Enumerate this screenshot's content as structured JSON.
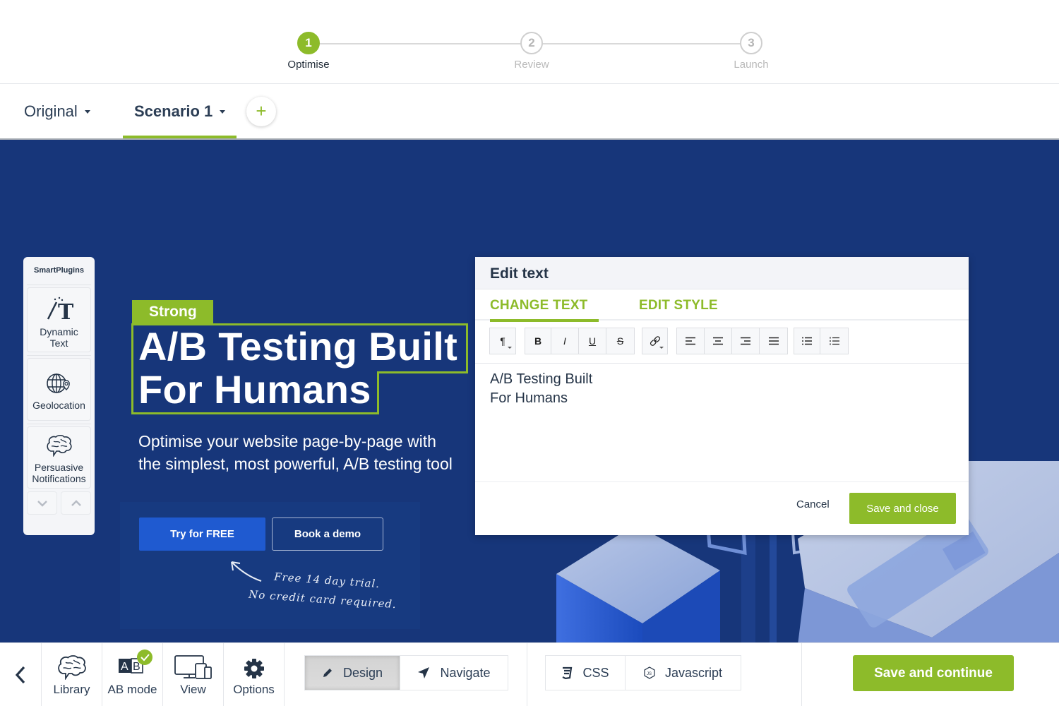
{
  "stepper": {
    "steps": [
      {
        "number": "1",
        "label": "Optimise",
        "state": "active"
      },
      {
        "number": "2",
        "label": "Review",
        "state": "inactive"
      },
      {
        "number": "3",
        "label": "Launch",
        "state": "inactive"
      }
    ]
  },
  "scenarios": {
    "tabs": [
      {
        "label": "Original",
        "active": false
      },
      {
        "label": "Scenario 1",
        "active": true
      }
    ],
    "add_label": "+"
  },
  "smart_plugins": {
    "title": "SmartPlugins",
    "items": [
      {
        "label_line1": "Dynamic",
        "label_line2": "Text",
        "icon": "dynamic-text-icon"
      },
      {
        "label_line1": "Geolocation",
        "label_line2": "",
        "icon": "geolocation-icon"
      },
      {
        "label_line1": "Persuasive",
        "label_line2": "Notifications",
        "icon": "brain-icon"
      }
    ]
  },
  "page": {
    "badge": "Strong",
    "headline_line1": "A/B Testing Built",
    "headline_line2": "For Humans",
    "subtext_line1": "Optimise your website page-by-page with",
    "subtext_line2": "the simplest, most powerful, A/B testing tool",
    "cta_primary": "Try for FREE",
    "cta_secondary": "Book a demo",
    "note_line1": "Free 14 day trial.",
    "note_line2": "No credit card required."
  },
  "modal": {
    "title": "Edit text",
    "tabs": [
      {
        "label": "CHANGE TEXT",
        "active": true
      },
      {
        "label": "EDIT STYLE",
        "active": false
      }
    ],
    "toolbar": {
      "paragraph": "¶",
      "bold": "B",
      "italic": "I",
      "underline": "U",
      "strike": "S"
    },
    "content_line1": "A/B Testing Built",
    "content_line2": "For Humans",
    "cancel_label": "Cancel",
    "save_label": "Save and close"
  },
  "bottombar": {
    "tools": [
      {
        "label": "Library",
        "icon": "brain-icon"
      },
      {
        "label": "AB mode",
        "icon": "ab-mode-icon",
        "checked": true
      },
      {
        "label": "View",
        "icon": "devices-icon"
      },
      {
        "label": "Options",
        "icon": "gear-icon"
      }
    ],
    "modes": [
      {
        "label": "Design",
        "active": true
      },
      {
        "label": "Navigate",
        "active": false
      }
    ],
    "code": [
      {
        "label": "CSS"
      },
      {
        "label": "Javascript"
      }
    ],
    "save_continue": "Save and continue"
  },
  "colors": {
    "accent_green": "#8dbb2a",
    "canvas_blue": "#17367a",
    "cta_blue": "#1f5ad0",
    "text_dark": "#253447"
  }
}
